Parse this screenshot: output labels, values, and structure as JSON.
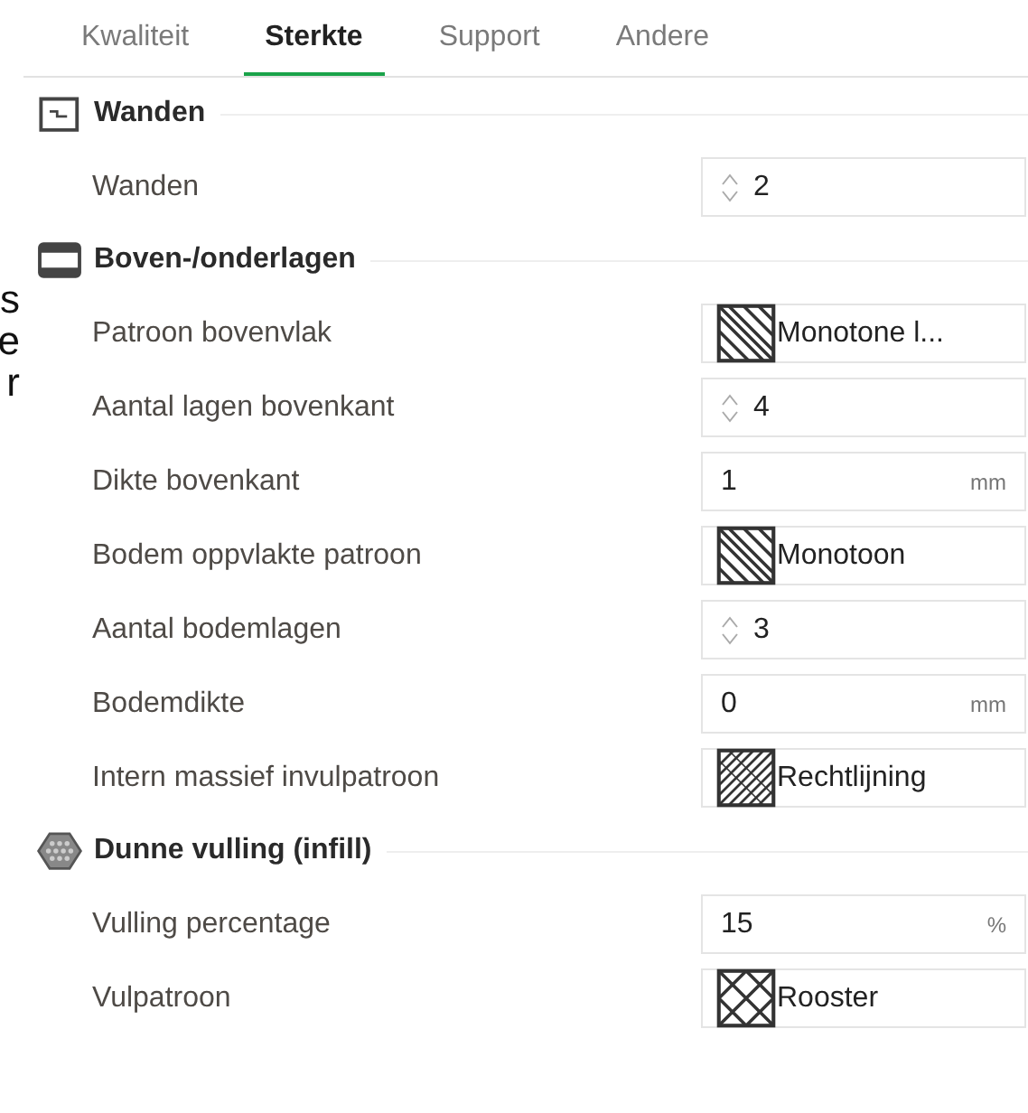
{
  "tabs": [
    {
      "label": "Kwaliteit",
      "selected": false
    },
    {
      "label": "Sterkte",
      "selected": true
    },
    {
      "label": "Support",
      "selected": false
    },
    {
      "label": "Andere",
      "selected": false
    }
  ],
  "edge_fragments": [
    "s",
    "e",
    "r"
  ],
  "sections": [
    {
      "title": "Wanden",
      "rows": [
        {
          "label": "Wanden",
          "kind": "spin",
          "value": "2"
        }
      ]
    },
    {
      "title": "Boven-/onderlagen",
      "rows": [
        {
          "label": "Patroon bovenvlak",
          "kind": "pattern",
          "value": "Monotone l..."
        },
        {
          "label": "Aantal lagen bovenkant",
          "kind": "spin",
          "value": "4"
        },
        {
          "label": "Dikte bovenkant",
          "kind": "unit",
          "value": "1",
          "unit": "mm"
        },
        {
          "label": "Bodem oppvlakte patroon",
          "kind": "pattern",
          "value": "Monotoon"
        },
        {
          "label": "Aantal bodemlagen",
          "kind": "spin",
          "value": "3"
        },
        {
          "label": "Bodemdikte",
          "kind": "unit",
          "value": "0",
          "unit": "mm"
        },
        {
          "label": "Intern massief invulpatroon",
          "kind": "pattern",
          "value": "Rechtlijning"
        }
      ]
    },
    {
      "title": "Dunne vulling (infill)",
      "rows": [
        {
          "label": "Vulling percentage",
          "kind": "unit",
          "value": "15",
          "unit": "%"
        },
        {
          "label": "Vulpatroon",
          "kind": "pattern",
          "value": "Rooster"
        }
      ]
    }
  ]
}
